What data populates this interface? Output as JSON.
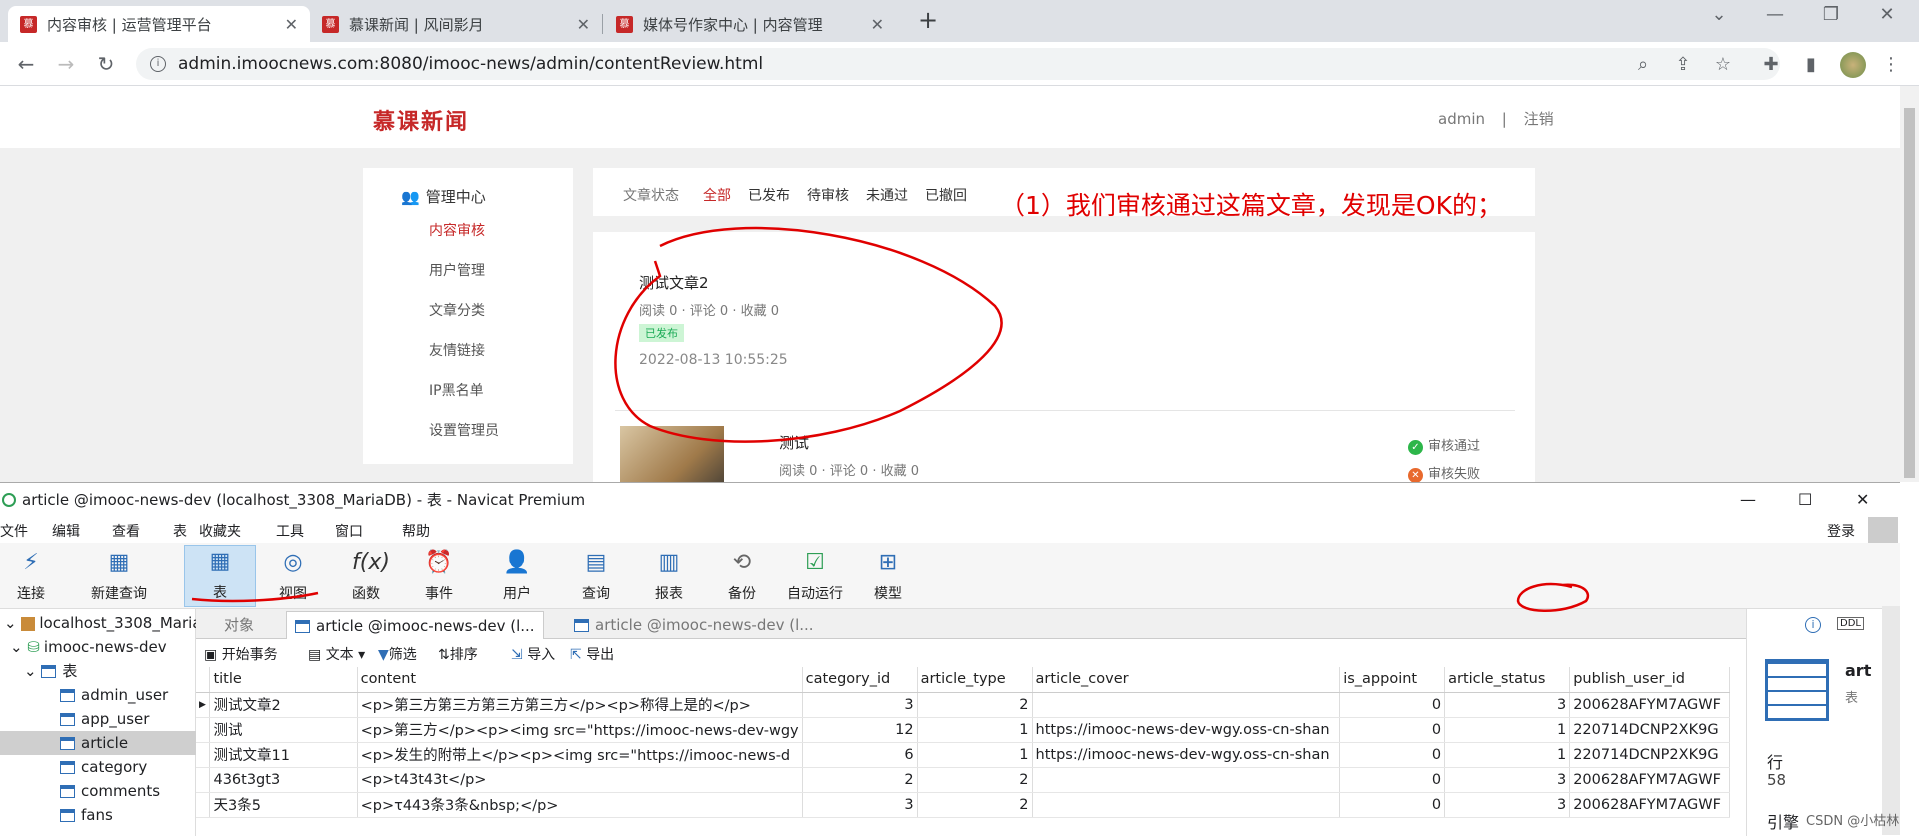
{
  "browser": {
    "tabs": [
      {
        "title": "内容审核 | 运营管理平台",
        "active": true
      },
      {
        "title": "慕课新闻 | 风间影月",
        "active": false
      },
      {
        "title": "媒体号作家中心 | 内容管理",
        "active": false
      }
    ],
    "favicon_text": "慕",
    "new_tab": "+",
    "url": "admin.imoocnews.com:8080/imooc-news/admin/contentReview.html"
  },
  "site": {
    "logo": "慕课新闻",
    "user": "admin",
    "separator": "|",
    "logout": "注销",
    "sidebar": {
      "title": "管理中心",
      "items": [
        "内容审核",
        "用户管理",
        "文章分类",
        "友情链接",
        "IP黑名单",
        "设置管理员"
      ]
    },
    "filter": {
      "label": "文章状态",
      "options": [
        "全部",
        "已发布",
        "待审核",
        "未通过",
        "已撤回"
      ]
    },
    "articles": [
      {
        "title": "测试文章2",
        "stats": "阅读 0 · 评论 0 · 收藏 0",
        "badge": "已发布",
        "time": "2022-08-13 10:55:25"
      },
      {
        "title": "测试",
        "stats": "阅读 0 · 评论 0 · 收藏 0",
        "approve": "审核通过",
        "reject": "审核失败"
      }
    ],
    "annotation": "（1）我们审核通过这篇文章，发现是OK的；"
  },
  "navicat": {
    "title": "article @imooc-news-dev (localhost_3308_MariaDB) - 表 - Navicat Premium",
    "menu": [
      "文件",
      "编辑",
      "查看",
      "表",
      "收藏夹",
      "工具",
      "窗口",
      "帮助"
    ],
    "login": "登录",
    "ribbon": [
      {
        "label": "连接",
        "icon": "plug-icon"
      },
      {
        "label": "新建查询",
        "icon": "new-query-icon"
      },
      {
        "label": "表",
        "icon": "table-icon"
      },
      {
        "label": "视图",
        "icon": "view-icon"
      },
      {
        "label": "函数",
        "icon": "function-icon"
      },
      {
        "label": "事件",
        "icon": "clock-icon"
      },
      {
        "label": "用户",
        "icon": "user-icon"
      },
      {
        "label": "查询",
        "icon": "query-icon"
      },
      {
        "label": "报表",
        "icon": "report-icon"
      },
      {
        "label": "备份",
        "icon": "backup-icon"
      },
      {
        "label": "自动运行",
        "icon": "auto-run-icon"
      },
      {
        "label": "模型",
        "icon": "model-icon"
      }
    ],
    "tree": {
      "connection": "localhost_3308_MariaDB",
      "database": "imooc-news-dev",
      "tables_label": "表",
      "tables": [
        "admin_user",
        "app_user",
        "article",
        "category",
        "comments",
        "fans"
      ]
    },
    "tabs": [
      "对象",
      "article @imooc-news-dev (l...",
      "article @imooc-news-dev (l..."
    ],
    "subtoolbar": [
      "开始事务",
      "文本",
      "筛选",
      "排序",
      "导入",
      "导出"
    ],
    "columns": [
      "title",
      "content",
      "category_id",
      "article_type",
      "article_cover",
      "is_appoint",
      "article_status",
      "publish_user_id"
    ],
    "rows": [
      [
        "测试文章2",
        "<p>第三方第三方第三方第三方</p><p>称得上是的</p>",
        "3",
        "2",
        "",
        "0",
        "3",
        "200628AFYM7AGWF"
      ],
      [
        "测试",
        "<p>第三方</p><p><img src=\"https://imooc-news-dev-wgy",
        "12",
        "1",
        "https://imooc-news-dev-wgy.oss-cn-shan",
        "0",
        "1",
        "220714DCNP2XK9G"
      ],
      [
        "测试文章11",
        "<p>发生的附带上</p><p><img src=\"https://imooc-news-d",
        "6",
        "1",
        "https://imooc-news-dev-wgy.oss-cn-shan",
        "0",
        "1",
        "220714DCNP2XK9G"
      ],
      [
        "436t3gt3",
        "<p>t43t43t</p>",
        "2",
        "2",
        "",
        "0",
        "3",
        "200628AFYM7AGWF"
      ],
      [
        "天3条5",
        "<p>τ443条3条&nbsp;</p>",
        "3",
        "2",
        "",
        "0",
        "3",
        "200628AFYM7AGWF"
      ]
    ],
    "right_panel": {
      "name": "art",
      "type": "表",
      "rows_label": "行",
      "rows_value": "58",
      "ref_label": "引擎"
    },
    "watermark": "CSDN @小枯林"
  }
}
